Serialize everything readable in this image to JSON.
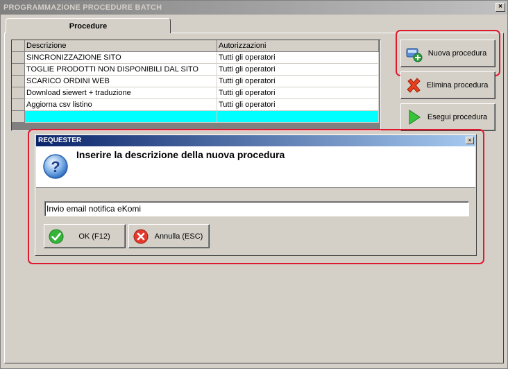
{
  "window": {
    "title": "PROGRAMMAZIONE PROCEDURE BATCH",
    "close_glyph": "×"
  },
  "tabs": [
    {
      "label": "Procedure"
    }
  ],
  "grid": {
    "columns": [
      "Descrizione",
      "Autorizzazioni"
    ],
    "rows": [
      {
        "descrizione": "SINCRONIZZAZIONE SITO",
        "autorizzazioni": "Tutti gli operatori"
      },
      {
        "descrizione": "TOGLIE PRODOTTI NON DISPONIBILI DAL SITO",
        "autorizzazioni": "Tutti gli operatori"
      },
      {
        "descrizione": "SCARICO ORDINI WEB",
        "autorizzazioni": "Tutti gli operatori"
      },
      {
        "descrizione": "Download siewert + traduzione",
        "autorizzazioni": "Tutti gli operatori"
      },
      {
        "descrizione": "Aggiorna csv listino",
        "autorizzazioni": "Tutti gli operatori"
      },
      {
        "descrizione": "",
        "autorizzazioni": ""
      }
    ],
    "selected_row_color": "#00ffff"
  },
  "side_buttons": {
    "new": {
      "label": "Nuova procedura",
      "icon": "new-procedure-icon"
    },
    "delete": {
      "label": "Elimina procedura",
      "icon": "red-x-icon"
    },
    "run": {
      "label": "Esegui procedura",
      "icon": "green-play-icon"
    }
  },
  "requester": {
    "title": "REQUESTER",
    "close_glyph": "×",
    "message": "Inserire la descrizione della nuova procedura",
    "icon": "question-icon",
    "input_value": "Invio email notifica eKomi",
    "ok_label": "OK (F12)",
    "cancel_label": "Annulla (ESC)"
  },
  "colors": {
    "highlight": "#e01a2e",
    "dialog_title_start": "#0a246a",
    "dialog_title_end": "#a6caf0",
    "face": "#d4d0c8"
  }
}
